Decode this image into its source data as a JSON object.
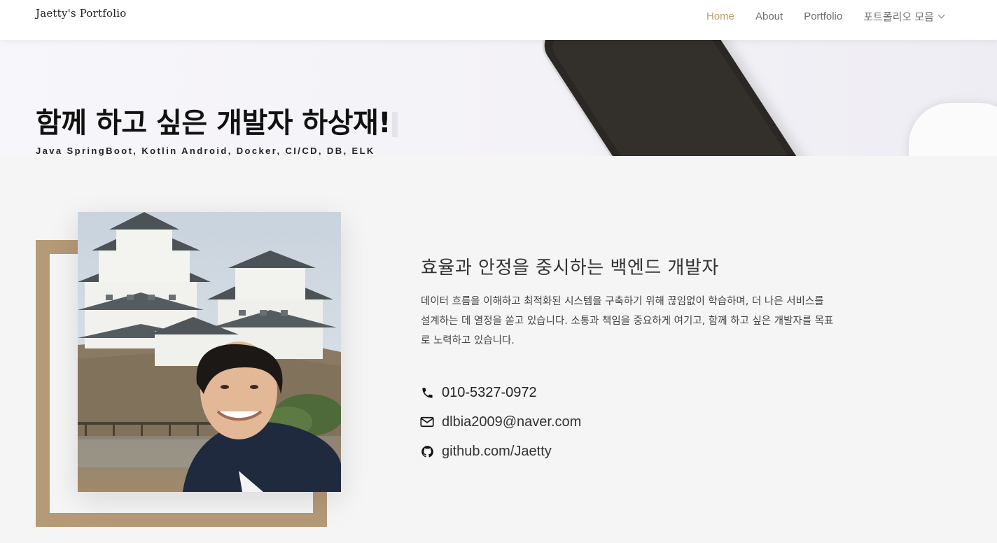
{
  "header": {
    "brand": "Jaetty's Portfolio",
    "nav": [
      {
        "label": "Home",
        "active": true
      },
      {
        "label": "About",
        "active": false
      },
      {
        "label": "Portfolio",
        "active": false
      },
      {
        "label": "포트폴리오 모음",
        "active": false,
        "dropdown": true
      }
    ]
  },
  "hero": {
    "title": "함께 하고 싶은 개발자 하상재!",
    "subtitle": "Java SpringBoot, Kotlin Android, Docker, CI/CD, DB, ELK"
  },
  "about": {
    "title": "효율과 안정을 중시하는 백엔드 개발자",
    "description": "데이터 흐름을 이해하고 최적화된 시스템을 구축하기 위해 끊임없이 학습하며, 더 나은 서비스를 설계하는 데 열정을 쏟고 있습니다. 소통과 책임을 중요하게 여기고, 함께 하고 싶은 개발자를 목표로 노력하고 있습니다.",
    "contacts": {
      "phone": {
        "icon": "phone-icon",
        "text": "010-5327-0972"
      },
      "email": {
        "icon": "envelope-icon",
        "text": "dlbia2009@naver.com"
      },
      "github": {
        "icon": "github-icon",
        "text": "github.com/Jaetty"
      }
    }
  },
  "colors": {
    "accent": "#c39b69",
    "frame": "#b59a77",
    "background": "#f5f5f5"
  }
}
